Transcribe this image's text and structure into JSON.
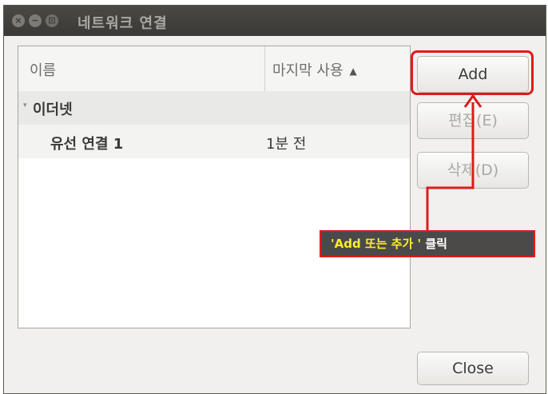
{
  "window": {
    "title": "네트워크 연결",
    "controls": {
      "close": "×",
      "minimize": "−",
      "maximize": "⊡"
    }
  },
  "list": {
    "columns": {
      "name": "이름",
      "last_used": "마지막 사용"
    },
    "sort_indicator": "▲",
    "group": {
      "chevron": "▾",
      "label": "이더넷"
    },
    "rows": [
      {
        "name": "유선 연결 1",
        "last_used": "1분 전"
      }
    ]
  },
  "buttons": {
    "add": "Add",
    "edit": "편집(E)",
    "delete": "삭제(D)",
    "close": "Close"
  },
  "annotation": {
    "highlight_text": "'Add 또는 추가 '",
    "rest_text": " 클릭",
    "color": "#e01a1a"
  }
}
